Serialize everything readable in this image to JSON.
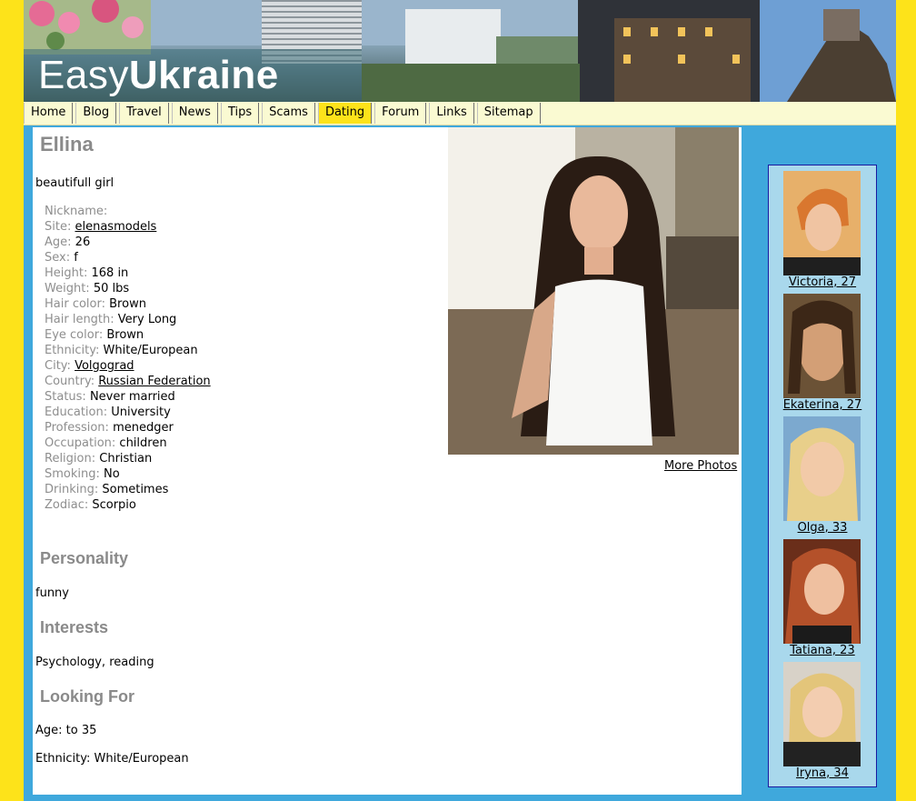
{
  "site": {
    "logo_light": "Easy",
    "logo_bold": "Ukraine"
  },
  "nav": {
    "items": [
      "Home",
      "Blog",
      "Travel",
      "News",
      "Tips",
      "Scams",
      "Dating",
      "Forum",
      "Links",
      "Sitemap"
    ],
    "active": "Dating"
  },
  "profile": {
    "name": "Ellina",
    "tagline": "beautifull girl",
    "details": {
      "nickname_label": "Nickname:",
      "nickname_value": "",
      "site_label": "Site:",
      "site_value": "elenasmodels",
      "age_label": "Age:",
      "age_value": "26",
      "sex_label": "Sex:",
      "sex_value": "f",
      "height_label": "Height:",
      "height_value": "168 in",
      "weight_label": "Weight:",
      "weight_value": "50 lbs",
      "hair_color_label": "Hair color:",
      "hair_color_value": "Brown",
      "hair_length_label": "Hair length:",
      "hair_length_value": "Very Long",
      "eye_color_label": "Eye color:",
      "eye_color_value": "Brown",
      "ethnicity_label": "Ethnicity:",
      "ethnicity_value": "White/European",
      "city_label": "City:",
      "city_value": "Volgograd",
      "country_label": "Country:",
      "country_value": "Russian Federation",
      "status_label": "Status:",
      "status_value": "Never married",
      "education_label": "Education:",
      "education_value": "University",
      "profession_label": "Profession:",
      "profession_value": "menedger",
      "occupation_label": "Occupation:",
      "occupation_value": "children",
      "religion_label": "Religion:",
      "religion_value": "Christian",
      "smoking_label": "Smoking:",
      "smoking_value": "No",
      "drinking_label": "Drinking:",
      "drinking_value": "Sometimes",
      "zodiac_label": "Zodiac:",
      "zodiac_value": "Scorpio"
    },
    "more_photos": "More Photos",
    "personality_title": "Personality",
    "personality_text": "funny",
    "interests_title": "Interests",
    "interests_text": "Psychology, reading",
    "looking_for_title": "Looking For",
    "looking_for_age": "Age: to 35",
    "looking_for_ethnicity": "Ethnicity: White/European"
  },
  "sidebar": {
    "profiles": [
      {
        "label": "Victoria, 27"
      },
      {
        "label": "Ekaterina, 27"
      },
      {
        "label": "Olga, 33"
      },
      {
        "label": "Tatiana, 23"
      },
      {
        "label": "Iryna, 34"
      }
    ]
  },
  "colors": {
    "page_background": "#fde31a",
    "frame_blue": "#3fa8dc",
    "nav_background": "#fafad2",
    "nav_active": "#fde31a",
    "heading_gray": "#8a8a8a",
    "sidebar_background": "#a9d8ec"
  }
}
